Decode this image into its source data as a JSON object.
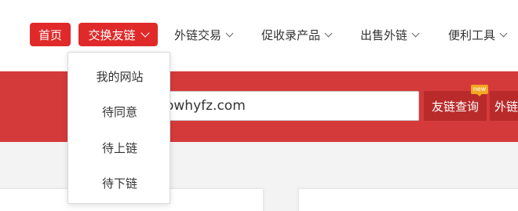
{
  "nav": {
    "home": "首页",
    "exchange": "交换友链",
    "trade": "外链交易",
    "promo": "促收录产品",
    "sell": "出售外链",
    "tools": "便利工具"
  },
  "dropdown": {
    "items": [
      "我的网站",
      "待同意",
      "待上链",
      "待下链"
    ]
  },
  "search": {
    "value": "owhyfz.com",
    "query_button": "友链查询",
    "outer_button": "外链",
    "badge": "new"
  },
  "colors": {
    "primary_red": "#e02a2a",
    "banner_red": "#d53a3a",
    "button_red": "#b92b2b",
    "badge_orange": "#f5a623"
  }
}
